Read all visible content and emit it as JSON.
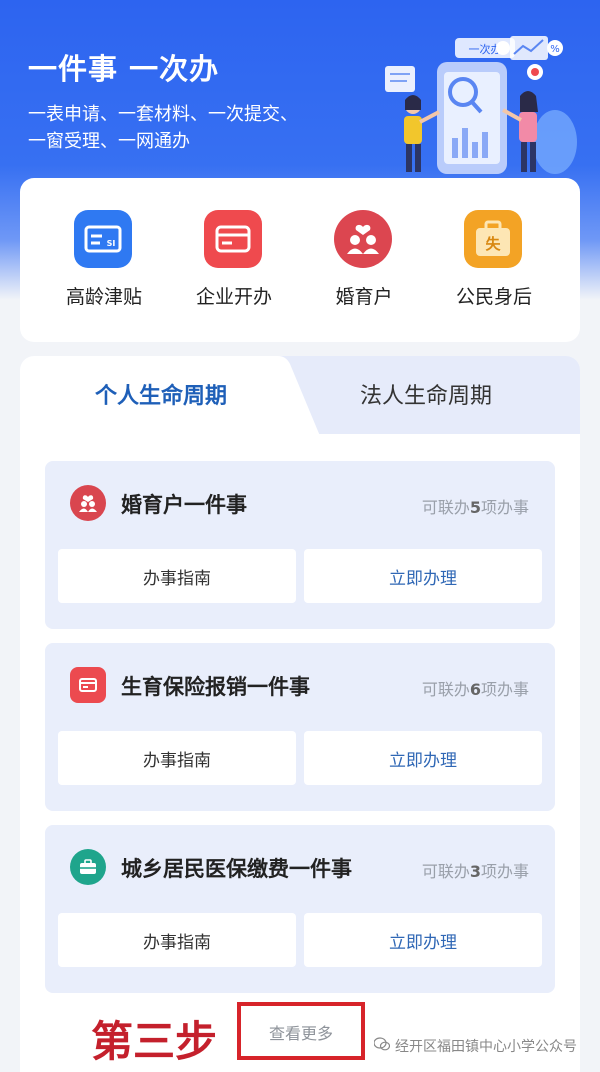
{
  "header": {
    "title": "一件事 一次办",
    "subtitle_line1": "一表申请、一套材料、一次提交、",
    "subtitle_line2": "一窗受理、一网通办",
    "illustration_tag": "一次办",
    "illustration_icon": "people-with-phone-illustration"
  },
  "quick_services": [
    {
      "label": "高龄津贴",
      "icon": "si-card-icon",
      "color": "#2f79f2"
    },
    {
      "label": "企业开办",
      "icon": "credit-card-icon",
      "color": "#ef4a4e"
    },
    {
      "label": "婚育户",
      "icon": "couple-heart-icon",
      "color": "#dc4650"
    },
    {
      "label": "公民身后",
      "icon": "briefcase-icon",
      "color": "#f3a325",
      "glyph": "失"
    }
  ],
  "tabs": [
    {
      "label": "个人生命周期",
      "active": true
    },
    {
      "label": "法人生命周期",
      "active": false
    }
  ],
  "life_items": [
    {
      "title": "婚育户一件事",
      "count_prefix": "可联办",
      "count": "5",
      "count_suffix": "项办事",
      "icon": "couple-heart-icon",
      "icon_color": "#d9464f",
      "guide_label": "办事指南",
      "apply_label": "立即办理"
    },
    {
      "title": "生育保险报销一件事",
      "count_prefix": "可联办",
      "count": "6",
      "count_suffix": "项办事",
      "icon": "credit-card-icon",
      "icon_color": "#ec4a4f",
      "guide_label": "办事指南",
      "apply_label": "立即办理"
    },
    {
      "title": "城乡居民医保缴费一件事",
      "count_prefix": "可联办",
      "count": "3",
      "count_suffix": "项办事",
      "icon": "medical-kit-icon",
      "icon_color": "#1fa58c",
      "guide_label": "办事指南",
      "apply_label": "立即办理"
    }
  ],
  "annotation": {
    "step": "第三步"
  },
  "more_label": "查看更多",
  "watermark": "经开区福田镇中心小学公众号"
}
